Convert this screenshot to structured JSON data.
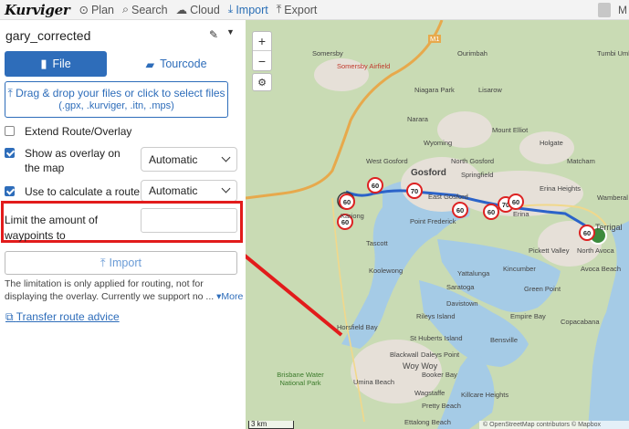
{
  "nav": {
    "logo": "Kurviger",
    "items": [
      {
        "icon": "compass-icon",
        "label": "Plan"
      },
      {
        "icon": "search-icon",
        "label": "Search"
      },
      {
        "icon": "cloud-icon",
        "label": "Cloud"
      },
      {
        "icon": "import-icon",
        "label": "Import"
      },
      {
        "icon": "export-icon",
        "label": "Export"
      }
    ],
    "user_initial": "M"
  },
  "panel": {
    "route_name": "gary_corrected",
    "tabs": {
      "file": "File",
      "tourcode": "Tourcode"
    },
    "dropzone": {
      "line1": "Drag & drop your files or click to select files",
      "line2": "(.gpx, .kurviger, .itn, .mps)"
    },
    "extend_label": "Extend Route/Overlay",
    "overlay_label": "Show as overlay on the map",
    "overlay_select": "Automatic",
    "calculate_label": "Use to calculate a route",
    "calculate_select": "Automatic",
    "limit_label": "Limit the amount of waypoints to",
    "limit_value": "",
    "import_label": "Import",
    "note": "The limitation is only applied for routing, not for displaying the overlay. Currently we support no ...",
    "more_label": "More",
    "transfer_label": "Transfer route advice"
  },
  "map": {
    "zoom_in": "+",
    "zoom_out": "−",
    "scale_label": "3 km",
    "attribution": "© OpenStreetMap contributors © Mapbox",
    "speed_limits": [
      "60",
      "60",
      "70",
      "60",
      "60",
      "70",
      "60",
      "60",
      "60"
    ],
    "places": [
      "Somersby",
      "Somersby Airfield",
      "Ourimbah",
      "Lisarow",
      "Niagara Park",
      "Narara",
      "Mount Elliot",
      "Holgate",
      "Wyoming",
      "Matcham",
      "West Gosford",
      "Gosford",
      "North Gosford",
      "Springfield",
      "East Gosford",
      "Erina",
      "Erina Heights",
      "Wamberal",
      "Kariong",
      "Point Frederick",
      "Terrigal",
      "North Avoca",
      "Avoca Beach",
      "Pickett Valley",
      "Tascott",
      "Koolewong",
      "Yattalunga",
      "Kincumber",
      "Saratoga",
      "Davistown",
      "Green Point",
      "Empire Bay",
      "Horsfield Bay",
      "Rileys Island",
      "Copacabana",
      "St Huberts Island",
      "Bensville",
      "Blackwall",
      "Daleys Point",
      "Woy Woy",
      "Booker Bay",
      "Umina Beach",
      "Wagstaffe",
      "Killcare Heights",
      "Pretty Beach",
      "Ettalong Beach",
      "Brisbane Water National Park",
      "Tumbi Umbi",
      "M1"
    ]
  }
}
